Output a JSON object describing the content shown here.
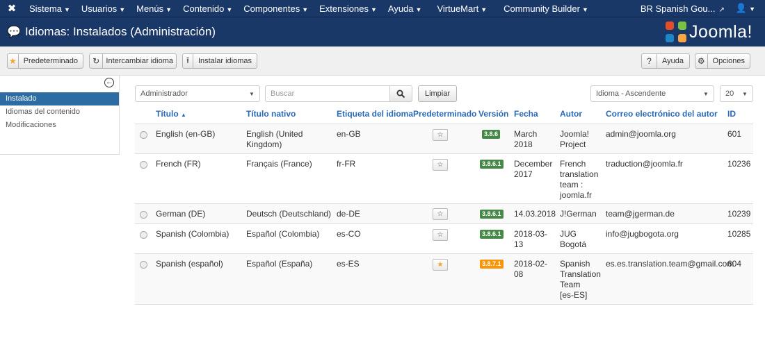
{
  "nav": {
    "items": [
      "Sistema",
      "Usuarios",
      "Menús",
      "Contenido",
      "Componentes",
      "Extensiones",
      "Ayuda",
      "VirtueMart",
      "Community Builder"
    ],
    "site_name": "BR Spanish Gou...",
    "user_icon": "user-icon"
  },
  "page": {
    "title": "Idiomas: Instalados (Administración)",
    "brand": "Joomla!"
  },
  "toolbar": {
    "default_label": "Predeterminado",
    "switch_label": "Intercambiar idioma",
    "install_label": "Instalar idiomas",
    "help_label": "Ayuda",
    "options_label": "Opciones"
  },
  "sidebar": {
    "items": [
      "Instalado",
      "Idiomas del contenido",
      "Modificaciones"
    ],
    "active": "Instalado"
  },
  "filters": {
    "client": "Administrador",
    "search_placeholder": "Buscar",
    "clear_label": "Limpiar",
    "ordering": "Idioma - Ascendente",
    "limit": "20"
  },
  "table": {
    "headers": [
      "Título",
      "Título nativo",
      "Etiqueta del idioma",
      "Predeterminado",
      "Versión",
      "Fecha",
      "Autor",
      "Correo electrónico del autor",
      "ID"
    ],
    "sort_indicator": "▲",
    "rows": [
      {
        "title": "English (en-GB)",
        "native": "English (United Kingdom)",
        "tag": "en-GB",
        "default": false,
        "version": "3.8.6",
        "date": "March 2018",
        "author": "Joomla! Project",
        "email": "admin@joomla.org",
        "id": "601"
      },
      {
        "title": "French (FR)",
        "native": "Français (France)",
        "tag": "fr-FR",
        "default": false,
        "version": "3.8.6.1",
        "date": "December 2017",
        "author": "French translation team : joomla.fr",
        "email": "traduction@joomla.fr",
        "id": "10236"
      },
      {
        "title": "German (DE)",
        "native": "Deutsch (Deutschland)",
        "tag": "de-DE",
        "default": false,
        "version": "3.8.6.1",
        "date": "14.03.2018",
        "author": "J!German",
        "email": "team@jgerman.de",
        "id": "10239"
      },
      {
        "title": "Spanish (Colombia)",
        "native": "Español (Colombia)",
        "tag": "es-CO",
        "default": false,
        "version": "3.8.6.1",
        "date": "2018-03-13",
        "author": "JUG Bogotá",
        "email": "info@jugbogota.org",
        "id": "10285"
      },
      {
        "title": "Spanish (español)",
        "native": "Español (España)",
        "tag": "es-ES",
        "default": true,
        "version": "3.8.7.1",
        "date": "2018-02-08",
        "author": "Spanish Translation Team [es-ES]",
        "email": "es.es.translation.team@gmail.com",
        "id": "604"
      }
    ]
  },
  "colors": {
    "navbar": "#1a3867",
    "link": "#2a69b8",
    "badge_ok": "#468847",
    "badge_warn": "#f89406",
    "sidebar_active": "#2d6ca2"
  }
}
